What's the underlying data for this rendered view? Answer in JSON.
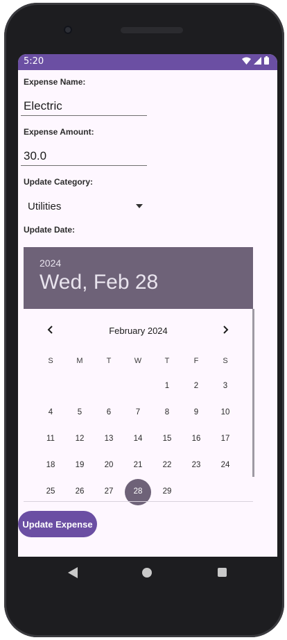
{
  "status_bar": {
    "time": "5:20",
    "icons": [
      "wifi-icon",
      "signal-icon",
      "battery-icon"
    ]
  },
  "form": {
    "name_label": "Expense Name:",
    "name_value": "Electric",
    "amount_label": "Expense Amount:",
    "amount_value": "30.0",
    "category_label": "Update Category:",
    "category_value": "Utilities",
    "date_label": "Update Date:"
  },
  "date_picker": {
    "year": "2024",
    "selected_date": "Wed, Feb 28",
    "month_title": "February 2024",
    "weekdays": [
      "S",
      "M",
      "T",
      "W",
      "T",
      "F",
      "S"
    ],
    "weeks": [
      [
        "",
        "",
        "",
        "",
        "1",
        "2",
        "3"
      ],
      [
        "4",
        "5",
        "6",
        "7",
        "8",
        "9",
        "10"
      ],
      [
        "11",
        "12",
        "13",
        "14",
        "15",
        "16",
        "17"
      ],
      [
        "18",
        "19",
        "20",
        "21",
        "22",
        "23",
        "24"
      ],
      [
        "25",
        "26",
        "27",
        "28",
        "29",
        "",
        ""
      ]
    ],
    "selected_day": "28",
    "accent_color": "#6e6278"
  },
  "actions": {
    "update_button": "Update Expense"
  },
  "colors": {
    "primary": "#6b4fa3",
    "surface": "#fef7ff"
  }
}
